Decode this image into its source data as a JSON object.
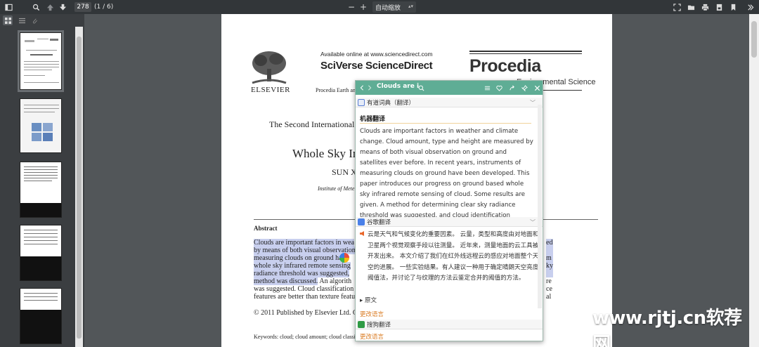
{
  "toolbar": {
    "page_number": "278",
    "page_count": "(1 / 6)",
    "zoom_out": "−",
    "zoom_in": "+",
    "zoom_select": "自动缩放"
  },
  "icons": [
    "sidebar-toggle-icon",
    "search-icon",
    "arrow-up-icon",
    "arrow-down-icon",
    "fullscreen-icon",
    "open-file-icon",
    "print-icon",
    "download-icon",
    "bookmark-icon",
    "menu-double-chevron-icon",
    "thumbnail-grid-icon",
    "outline-list-icon",
    "attachment-icon"
  ],
  "document": {
    "available": "Available online at www.sciencedirect.com",
    "sciverse": "SciVerse ScienceDirect",
    "elsevier": "ELSEVIER",
    "journal": "Procedia Earth an",
    "procedia": "Procedia",
    "procedia_sub": "Environmental Science",
    "conference": "The Second International",
    "title": "Whole Sky In",
    "author": "SUN X",
    "institute": "Institute of Mete",
    "abstract_heading": "Abstract",
    "abstract_lines": [
      "Clouds are important factors in wea",
      "by means of both visual observation",
      "measuring clouds on ground ha",
      "whole sky infrared remote sensing",
      "radiance threshold was suggested,",
      "method was discussed.",
      "was suggested. Cloud classification",
      "features are better than texture featu"
    ],
    "abstract_line6_rest": "An algorith",
    "right_fragments": [
      "ed",
      "m",
      "ky",
      "re",
      "ce",
      "al"
    ],
    "copyright": "© 2011 Published by Elsevier Ltd. C",
    "keywords": "Keywords: cloud; cloud amount; cloud classi"
  },
  "popup": {
    "query": "Clouds are i",
    "youdao_label": "有道词典（翻译）",
    "machine_title": "机器翻译",
    "english": "Clouds are important factors in weather and climate change. Cloud amount, type and height are measured by means of both visual observation on ground and satellites ever before. In recent years, instruments of measuring clouds on ground have been developed. This paper introduces our progress on ground based whole sky infrared remote sensing of cloud. Some results are given. A method for determining clear sky radiance threshold was suggested, and cloud identification combined",
    "google_label": "谷歌翻译",
    "chinese": "云是天气和气候变化的重要因素。 云量，类型和高度由对地面和卫星两个视觉观察手段以往测量。 近年来，测量地面的云工具被开发出来。 本文介绍了我们在红外线远程云的感应对地面整个天空的进展。 一些实验结果。有人建议一种用于确定晴朗天空亮度阈值法，并讨论了与纹理的方法云鉴定合并的阈值的方法。",
    "original": "▸ 原文",
    "change_language": "更改语言",
    "sogou_label": "搜狗翻译",
    "youdao_color": "#5b7fd6",
    "google_color": "#4a80e8",
    "sogou_color": "#2f9b45"
  },
  "watermark": "www.rjtj.cn软荐网"
}
